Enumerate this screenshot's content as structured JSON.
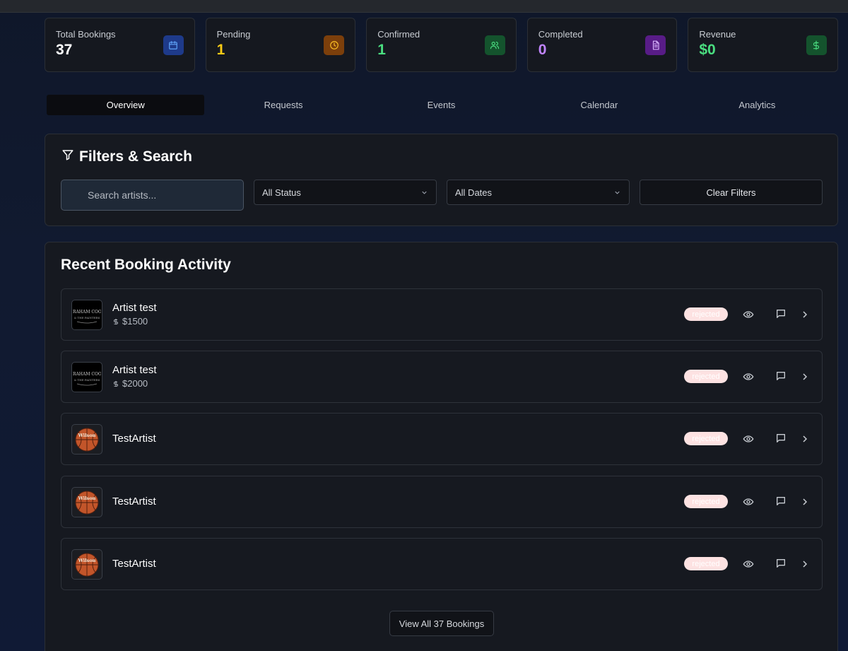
{
  "stats": [
    {
      "label": "Total Bookings",
      "value": "37",
      "value_color": "#ffffff",
      "icon": "calendar-icon",
      "icon_bg": "#1e3a8a",
      "icon_color": "#60a5fa"
    },
    {
      "label": "Pending",
      "value": "1",
      "value_color": "#facc15",
      "icon": "clock-icon",
      "icon_bg": "#7c3f0b",
      "icon_color": "#fbbf24"
    },
    {
      "label": "Confirmed",
      "value": "1",
      "value_color": "#4ade80",
      "icon": "users-icon",
      "icon_bg": "#14532d",
      "icon_color": "#4ade80"
    },
    {
      "label": "Completed",
      "value": "0",
      "value_color": "#c084fc",
      "icon": "document-icon",
      "icon_bg": "#581c87",
      "icon_color": "#d8b4fe"
    },
    {
      "label": "Revenue",
      "value": "$0",
      "value_color": "#4ade80",
      "icon": "dollar-icon",
      "icon_bg": "#14532d",
      "icon_color": "#4ade80"
    }
  ],
  "tabs": [
    {
      "label": "Overview",
      "active": true
    },
    {
      "label": "Requests",
      "active": false
    },
    {
      "label": "Events",
      "active": false
    },
    {
      "label": "Calendar",
      "active": false
    },
    {
      "label": "Analytics",
      "active": false
    }
  ],
  "filters": {
    "title": "Filters & Search",
    "search_placeholder": "Search artists...",
    "status_value": "All Status",
    "date_value": "All Dates",
    "clear_label": "Clear Filters"
  },
  "activity": {
    "title": "Recent Booking Activity",
    "rows": [
      {
        "name": "Artist test",
        "price": "$1500",
        "status": "rejected",
        "avatar": "band-logo"
      },
      {
        "name": "Artist test",
        "price": "$2000",
        "status": "rejected",
        "avatar": "band-logo"
      },
      {
        "name": "TestArtist",
        "price": "",
        "status": "rejected",
        "avatar": "basketball"
      },
      {
        "name": "TestArtist",
        "price": "",
        "status": "rejected",
        "avatar": "basketball"
      },
      {
        "name": "TestArtist",
        "price": "",
        "status": "rejected",
        "avatar": "basketball"
      }
    ],
    "view_all_label": "View All 37 Bookings"
  },
  "avatars": {
    "band_logo_text_line1": "GRAHAM COOL",
    "band_logo_text_line2": "& THE PAINTERS",
    "ball_brand": "Wilson"
  }
}
